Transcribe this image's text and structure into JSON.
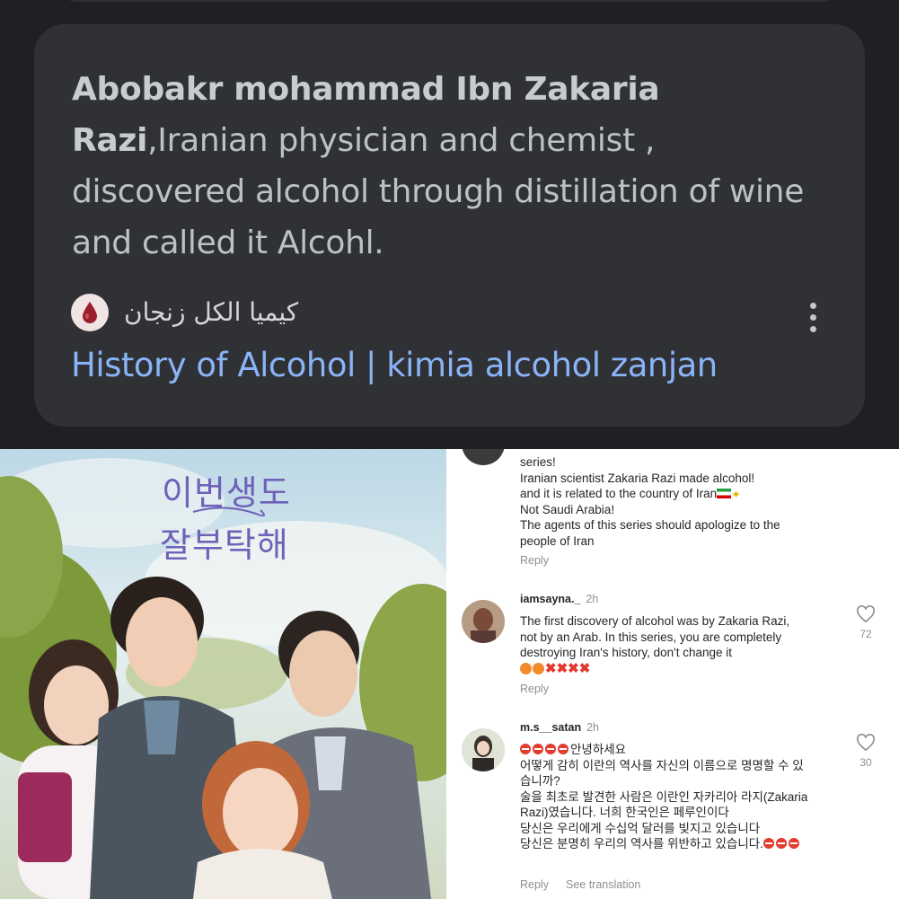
{
  "search_result": {
    "snippet_bold": "Abobakr mohammad Ibn Zakaria Razi",
    "snippet_rest": ",Iranian physician and chemist , discovered alcohol through distillation of wine and called it Alcohl.",
    "site_name": "كيميا الكل زنجان",
    "title": "History of Alcohol | kimia alcohol zanjan",
    "favicon_icon": "blood-drop-icon",
    "more_icon": "more-vert-icon"
  },
  "poster": {
    "title_line1": "이번생도",
    "title_line2": "잘부탁해"
  },
  "comments": {
    "partial_top": {
      "lines": [
        "series!",
        "Iranian scientist Zakaria Razi made alcohol!",
        "and it is related to the country of Iran",
        "Not Saudi Arabia!",
        "The agents of this series should apologize to the",
        "people of Iran"
      ],
      "reply": "Reply"
    },
    "items": [
      {
        "username": "iamsayna._",
        "time": "2h",
        "lines": [
          "The first discovery of alcohol was by Zakaria Razi,",
          "not by an Arab. In this series, you are completely",
          "destroying Iran's history, don't change it"
        ],
        "likes": "72",
        "reply": "Reply"
      },
      {
        "username": "m.s__satan",
        "time": "2h",
        "lines": [
          "안녕하세요",
          "어떻게 감히 이란의 역사를 자신의 이름으로 명명할 수 있",
          "습니까?",
          "술을 최초로 발견한 사람은 이란인 자카리아 라지(Zakaria",
          "Razi)였습니다. 너희 한국인은 페루인이다",
          "당신은 우리에게 수십억 달러를 빚지고 있습니다",
          "당신은 분명히 우리의 역사를 위반하고 있습니다."
        ],
        "likes": "30",
        "reply": "Reply",
        "see_translation": "See translation"
      }
    ],
    "like_icon": "heart-outline-icon"
  },
  "colors": {
    "dark_bg": "#1f2024",
    "card_bg": "#303134",
    "link_blue": "#8ab4f8",
    "snippet_grey": "#bdc1c6",
    "poster_title_purple": "#6f62b8",
    "meta_grey": "#8e8e8e"
  }
}
